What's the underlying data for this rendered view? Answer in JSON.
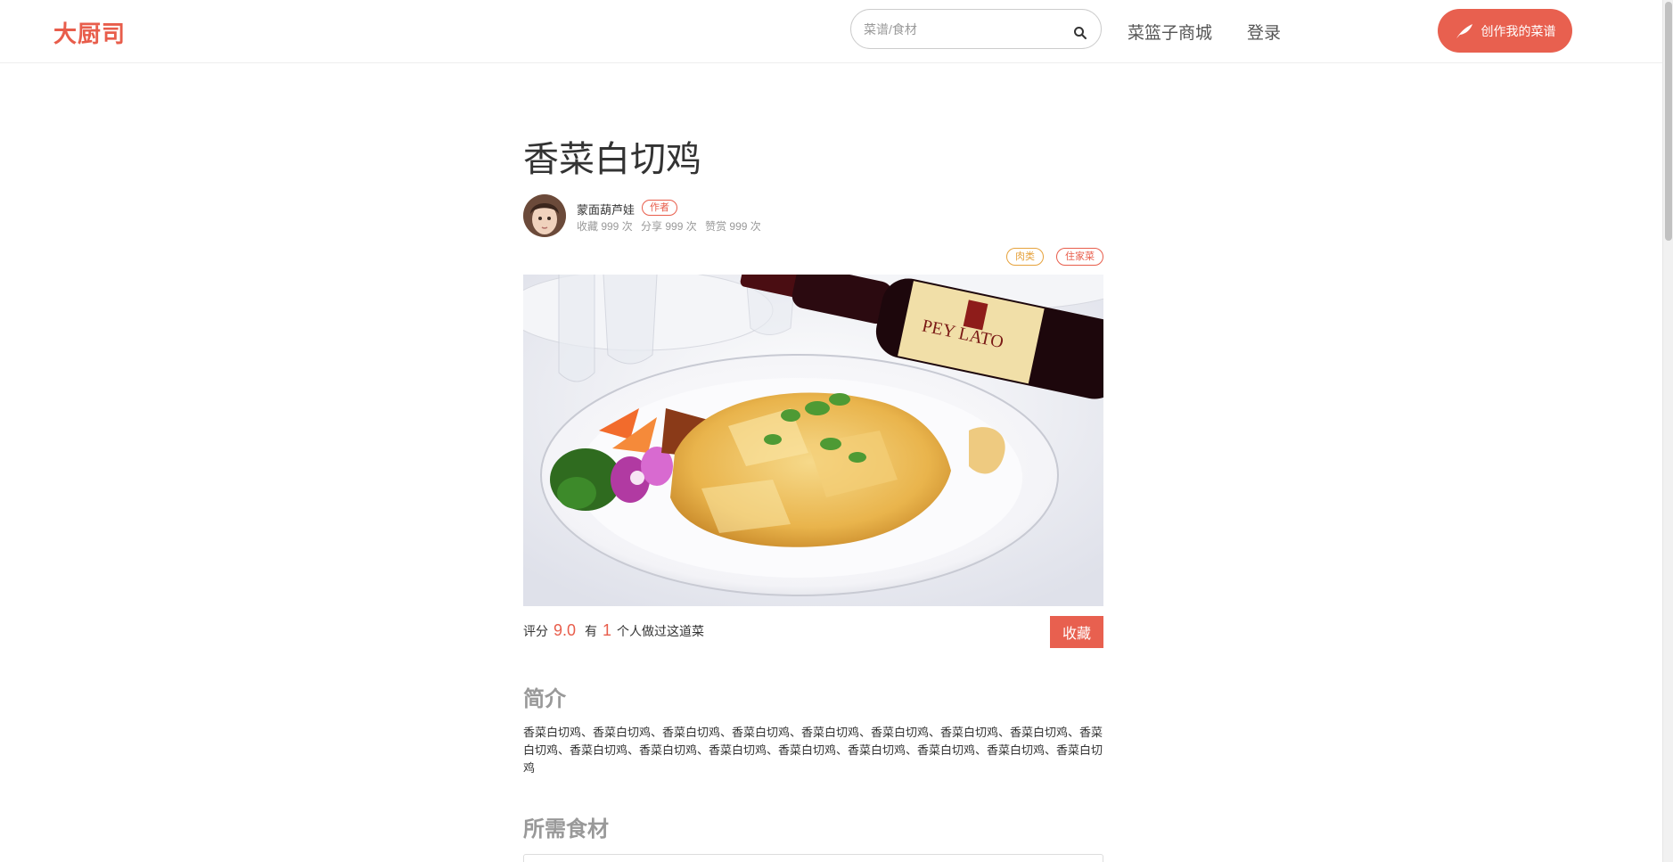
{
  "header": {
    "logo": "大厨司",
    "search_placeholder": "菜谱/食材",
    "nav_basket": "菜篮子商城",
    "nav_login": "登录",
    "create_button": "创作我的菜谱"
  },
  "recipe": {
    "title": "香菜白切鸡",
    "author": {
      "name": "蒙面葫芦娃",
      "badge": "作者",
      "stats": {
        "favorites": "收藏 999 次",
        "shares": "分享 999 次",
        "likes": "赞赏 999 次"
      }
    },
    "tags": [
      "肉类",
      "住家菜"
    ],
    "rating": {
      "label": "评分",
      "score": "9.0",
      "made_prefix": "有",
      "made_count": "1",
      "made_suffix": "个人做过这道菜"
    },
    "favorite_button": "收藏",
    "intro_heading": "简介",
    "intro_text": "香菜白切鸡、香菜白切鸡、香菜白切鸡、香菜白切鸡、香菜白切鸡、香菜白切鸡、香菜白切鸡、香菜白切鸡、香菜白切鸡、香菜白切鸡、香菜白切鸡、香菜白切鸡、香菜白切鸡、香菜白切鸡、香菜白切鸡、香菜白切鸡、香菜白切鸡",
    "ingredients_heading": "所需食材"
  },
  "colors": {
    "accent": "#e85d4b",
    "tag_meat": "#e6a23c",
    "muted": "#999999"
  },
  "icons": {
    "search": "search-icon",
    "create": "feather-icon"
  }
}
